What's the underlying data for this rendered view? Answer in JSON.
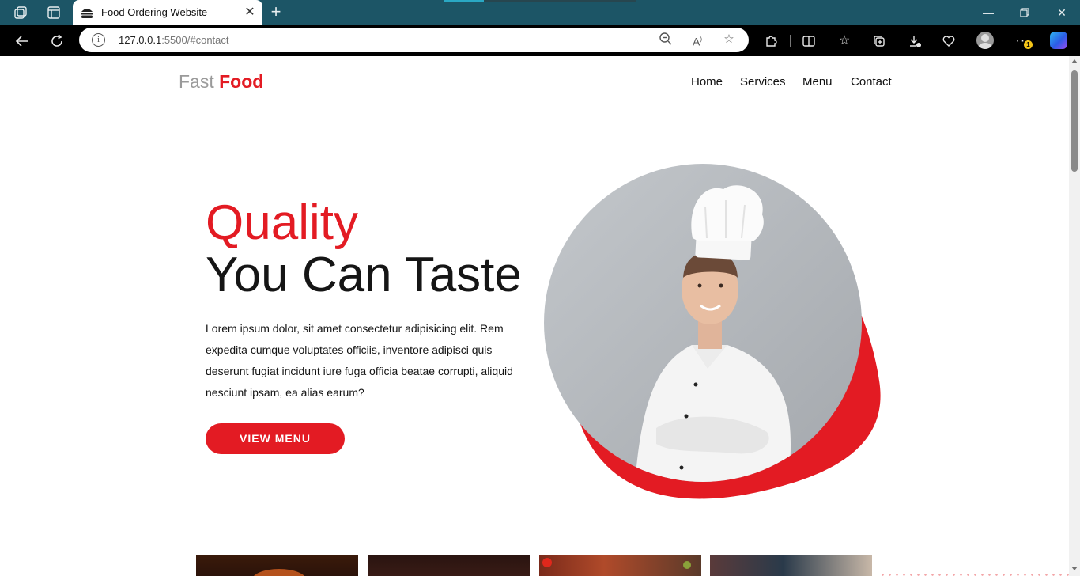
{
  "browser": {
    "tab_title": "Food Ordering Website",
    "url_host": "127.0.0.1",
    "url_path": ":5500/#contact",
    "notification_count": "1"
  },
  "site": {
    "logo_part1": "Fast",
    "logo_part2": "Food",
    "nav": [
      "Home",
      "Services",
      "Menu",
      "Contact"
    ]
  },
  "hero": {
    "title_line1": "Quality",
    "title_line2": "You Can Taste",
    "text": "Lorem ipsum dolor, sit amet consectetur adipisicing elit. Rem expedita cumque voluptates officiis, inventore adipisci quis deserunt fugiat incidunt iure fuga officia beatae corrupti, aliquid nesciunt ipsam, ea alias earum?",
    "button_label": "VIEW MENU"
  },
  "colors": {
    "brand_red": "#e31b23",
    "titlebar": "#1c5566",
    "logo_gray": "#9a9a9a"
  }
}
